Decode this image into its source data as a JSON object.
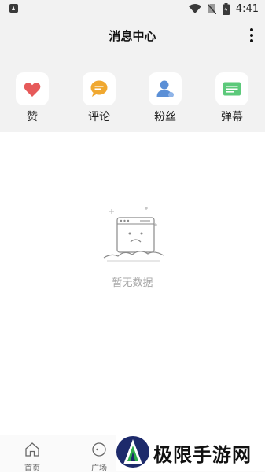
{
  "status_bar": {
    "time": "4:41"
  },
  "header": {
    "title": "消息中心"
  },
  "quick_actions": [
    {
      "label": "赞",
      "icon": "heart-icon"
    },
    {
      "label": "评论",
      "icon": "comment-bubble-icon"
    },
    {
      "label": "粉丝",
      "icon": "user-icon"
    },
    {
      "label": "弹幕",
      "icon": "danmaku-icon"
    }
  ],
  "empty_state": {
    "text": "暂无数据"
  },
  "tab_bar": [
    {
      "label": "首页",
      "icon": "home-icon"
    },
    {
      "label": "广场",
      "icon": "square-icon"
    }
  ],
  "watermark": {
    "text": "极限手游网"
  },
  "colors": {
    "header_bg": "#f2f2f2",
    "heart": "#e65a5a",
    "comment": "#f0a830",
    "user": "#5b8fd6",
    "danmaku": "#5cc97a"
  }
}
